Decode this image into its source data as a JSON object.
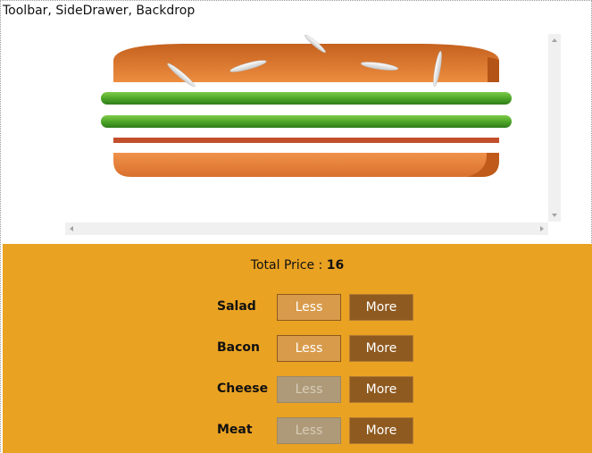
{
  "header": {
    "title": "Toolbar, SideDrawer, Backdrop"
  },
  "burger": {
    "ingredients": [
      "salad",
      "salad",
      "bacon"
    ],
    "colors": {
      "bread_top": "#cf6a24",
      "bread_bottom": "#e58a40",
      "salad": "#5cb532",
      "bacon": "#c7522a",
      "seed": "#f2f2f2"
    }
  },
  "order": {
    "price_label": "Total Price : ",
    "price_value": "16"
  },
  "controls": [
    {
      "label": "Salad",
      "less": "Less",
      "more": "More",
      "less_disabled": false
    },
    {
      "label": "Bacon",
      "less": "Less",
      "more": "More",
      "less_disabled": false
    },
    {
      "label": "Cheese",
      "less": "Less",
      "more": "More",
      "less_disabled": true
    },
    {
      "label": "Meat",
      "less": "Less",
      "more": "More",
      "less_disabled": true
    }
  ]
}
